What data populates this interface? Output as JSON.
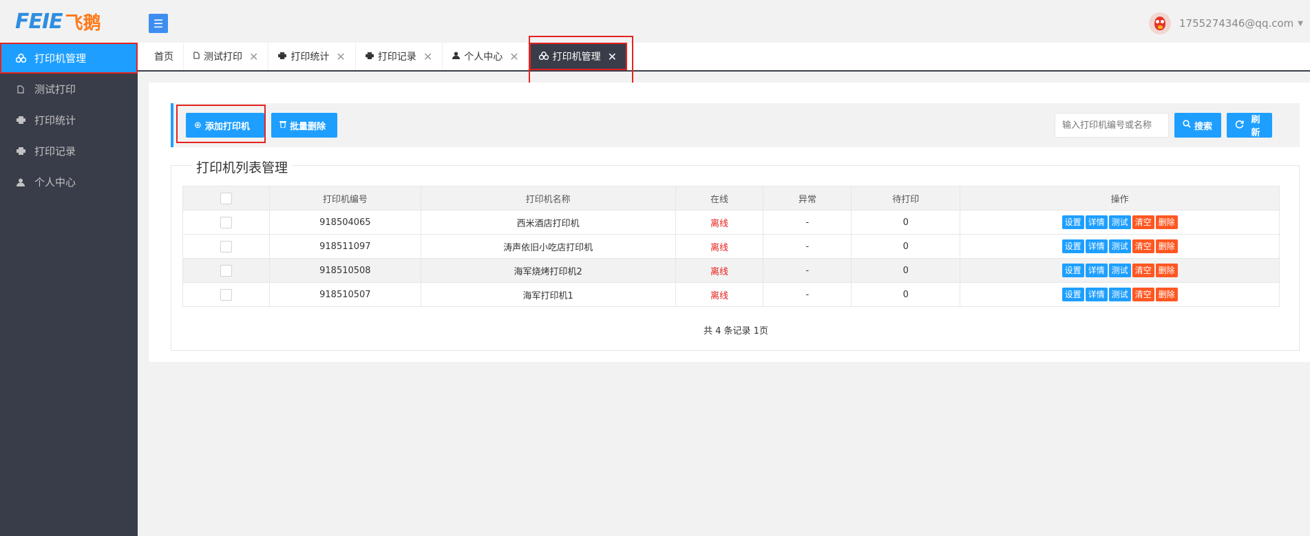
{
  "logo": {
    "text": "FEIE",
    "cn": "飞鹅"
  },
  "sidebar": {
    "items": [
      {
        "label": "打印机管理",
        "icon": "printer-group-icon",
        "active": true
      },
      {
        "label": "测试打印",
        "icon": "document-icon"
      },
      {
        "label": "打印统计",
        "icon": "printer-icon"
      },
      {
        "label": "打印记录",
        "icon": "printer-icon"
      },
      {
        "label": "个人中心",
        "icon": "user-icon"
      }
    ]
  },
  "header": {
    "menu_icon": "menu-icon",
    "user_email": "1755274346@qq.com"
  },
  "tabs": [
    {
      "label": "首页",
      "closable": false
    },
    {
      "label": "测试打印",
      "closable": true
    },
    {
      "label": "打印统计",
      "closable": true
    },
    {
      "label": "打印记录",
      "closable": true
    },
    {
      "label": "个人中心",
      "closable": true
    },
    {
      "label": "打印机管理",
      "closable": true,
      "active": true
    }
  ],
  "toolbar": {
    "add_label": "添加打印机",
    "batch_delete_label": "批量删除",
    "search_placeholder": "输入打印机编号或名称",
    "search_label": "搜索",
    "refresh_label": "刷新"
  },
  "list": {
    "title": "打印机列表管理",
    "columns": [
      "",
      "打印机编号",
      "打印机名称",
      "在线",
      "异常",
      "待打印",
      "操作"
    ],
    "rows": [
      {
        "sn": "918504065",
        "name": "西米酒店打印机",
        "online": "离线",
        "error": "-",
        "pending": "0"
      },
      {
        "sn": "918511097",
        "name": "涛声依旧小吃店打印机",
        "online": "离线",
        "error": "-",
        "pending": "0"
      },
      {
        "sn": "918510508",
        "name": "海军烧烤打印机2",
        "online": "离线",
        "error": "-",
        "pending": "0"
      },
      {
        "sn": "918510507",
        "name": "海军打印机1",
        "online": "离线",
        "error": "-",
        "pending": "0"
      }
    ],
    "actions": [
      "设置",
      "详情",
      "测试",
      "清空",
      "删除"
    ],
    "pager": "共 4 条记录 1页"
  },
  "colors": {
    "accent": "#1e9fff",
    "sidebar": "#393d49",
    "danger": "#e5221f",
    "warn": "#ff5722"
  }
}
